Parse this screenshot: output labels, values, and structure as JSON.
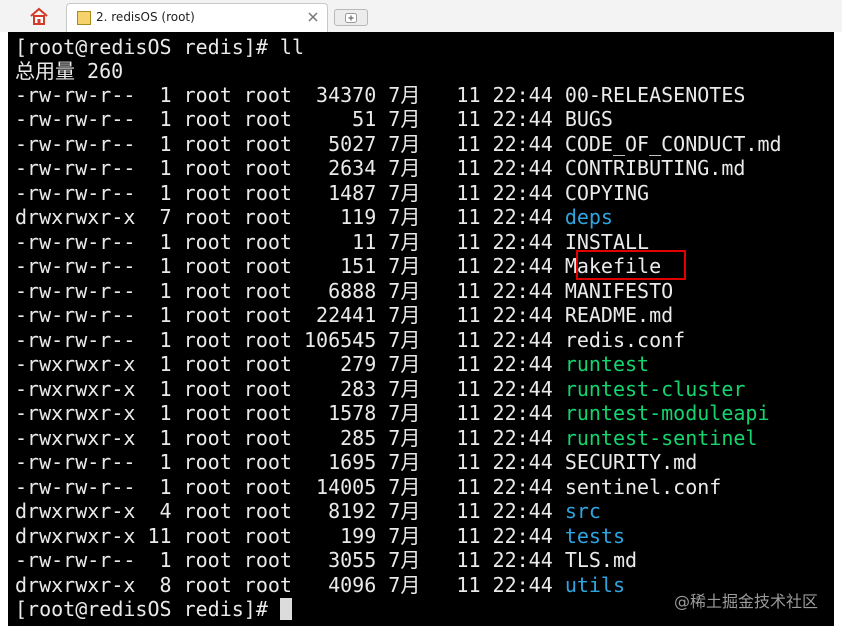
{
  "tabs": {
    "home_icon": "home-icon",
    "active_title": "2. redisOS (root)",
    "close_icon": "close-icon",
    "new_tab_icon": "new-tab-icon"
  },
  "terminal": {
    "command_line": "[root@redisOS redis]# ll",
    "total_line": "总用量 260",
    "entries": [
      {
        "meta": "-rw-rw-r--  1 root root  34370 7月   11 22:44 ",
        "name": "00-RELEASENOTES",
        "kind": "file"
      },
      {
        "meta": "-rw-rw-r--  1 root root     51 7月   11 22:44 ",
        "name": "BUGS",
        "kind": "file"
      },
      {
        "meta": "-rw-rw-r--  1 root root   5027 7月   11 22:44 ",
        "name": "CODE_OF_CONDUCT.md",
        "kind": "file"
      },
      {
        "meta": "-rw-rw-r--  1 root root   2634 7月   11 22:44 ",
        "name": "CONTRIBUTING.md",
        "kind": "file"
      },
      {
        "meta": "-rw-rw-r--  1 root root   1487 7月   11 22:44 ",
        "name": "COPYING",
        "kind": "file"
      },
      {
        "meta": "drwxrwxr-x  7 root root    119 7月   11 22:44 ",
        "name": "deps",
        "kind": "dir"
      },
      {
        "meta": "-rw-rw-r--  1 root root     11 7月   11 22:44 ",
        "name": "INSTALL",
        "kind": "file"
      },
      {
        "meta": "-rw-rw-r--  1 root root    151 7月   11 22:44 ",
        "name": "Makefile",
        "kind": "file"
      },
      {
        "meta": "-rw-rw-r--  1 root root   6888 7月   11 22:44 ",
        "name": "MANIFESTO",
        "kind": "file"
      },
      {
        "meta": "-rw-rw-r--  1 root root  22441 7月   11 22:44 ",
        "name": "README.md",
        "kind": "file"
      },
      {
        "meta": "-rw-rw-r--  1 root root 106545 7月   11 22:44 ",
        "name": "redis.conf",
        "kind": "file"
      },
      {
        "meta": "-rwxrwxr-x  1 root root    279 7月   11 22:44 ",
        "name": "runtest",
        "kind": "exec"
      },
      {
        "meta": "-rwxrwxr-x  1 root root    283 7月   11 22:44 ",
        "name": "runtest-cluster",
        "kind": "exec"
      },
      {
        "meta": "-rwxrwxr-x  1 root root   1578 7月   11 22:44 ",
        "name": "runtest-moduleapi",
        "kind": "exec"
      },
      {
        "meta": "-rwxrwxr-x  1 root root    285 7月   11 22:44 ",
        "name": "runtest-sentinel",
        "kind": "exec"
      },
      {
        "meta": "-rw-rw-r--  1 root root   1695 7月   11 22:44 ",
        "name": "SECURITY.md",
        "kind": "file"
      },
      {
        "meta": "-rw-rw-r--  1 root root  14005 7月   11 22:44 ",
        "name": "sentinel.conf",
        "kind": "file"
      },
      {
        "meta": "drwxrwxr-x  4 root root   8192 7月   11 22:44 ",
        "name": "src",
        "kind": "dir"
      },
      {
        "meta": "drwxrwxr-x 11 root root    199 7月   11 22:44 ",
        "name": "tests",
        "kind": "dir"
      },
      {
        "meta": "-rw-rw-r--  1 root root   3055 7月   11 22:44 ",
        "name": "TLS.md",
        "kind": "file"
      },
      {
        "meta": "drwxrwxr-x  8 root root   4096 7月   11 22:44 ",
        "name": "utils",
        "kind": "dir"
      }
    ],
    "prompt": "[root@redisOS redis]# ",
    "colors": {
      "background": "#000000",
      "text": "#eaeaea",
      "directory": "#2fa5e0",
      "executable": "#14d46e",
      "highlight_border": "#e00000"
    }
  },
  "watermark": "@稀土掘金技术社区"
}
